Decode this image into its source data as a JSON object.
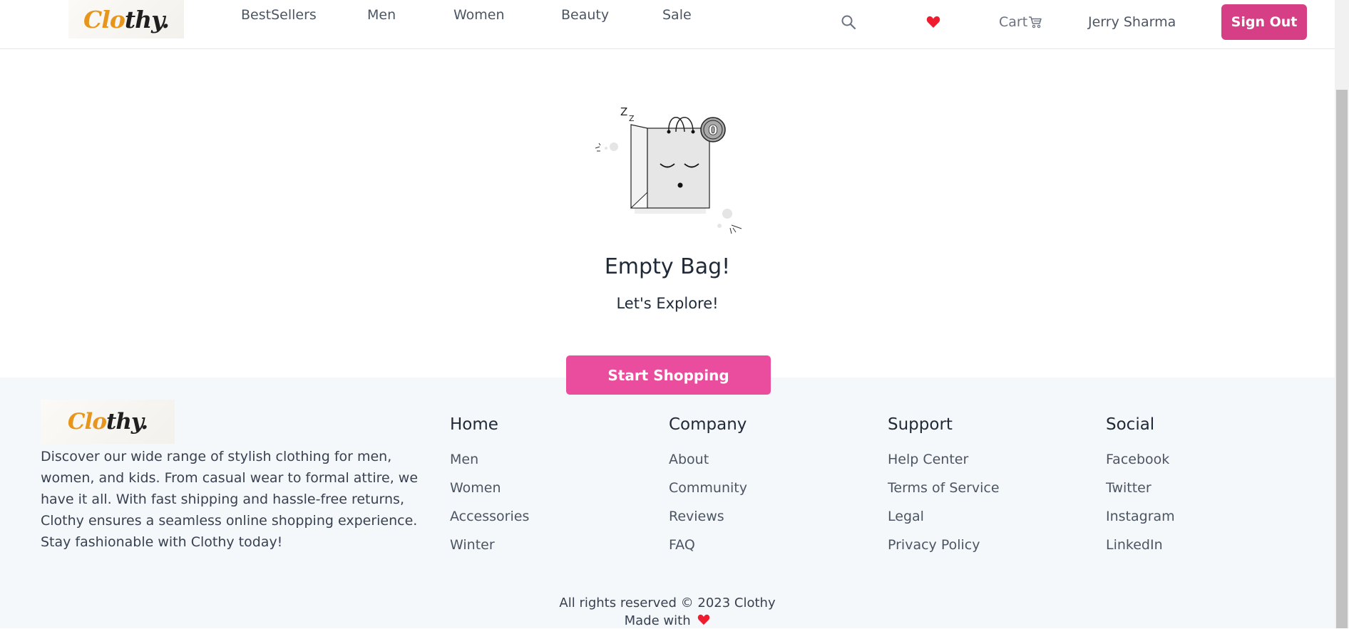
{
  "header": {
    "brand": {
      "part1": "Clo",
      "part2": "thy."
    },
    "nav": [
      {
        "label": "BestSellers"
      },
      {
        "label": "Men"
      },
      {
        "label": "Women"
      },
      {
        "label": "Beauty"
      },
      {
        "label": "Sale"
      }
    ],
    "search_icon": "search-icon",
    "wishlist_icon": "heart-icon",
    "cart_label": "Cart",
    "cart_icon": "cart-icon",
    "user_name": "Jerry Sharma",
    "signout_label": "Sign Out"
  },
  "empty_state": {
    "badge_count": "0",
    "sleep_text": "Z",
    "title": "Empty Bag!",
    "subtitle": "Let's Explore!",
    "button_label": "Start Shopping"
  },
  "footer": {
    "brand": {
      "part1": "Clo",
      "part2": "thy."
    },
    "description": "Discover our wide range of stylish clothing for men, women, and kids. From casual wear to formal attire, we have it all. With fast shipping and hassle-free returns, Clothy ensures a seamless online shopping experience. Stay fashionable with Clothy today!",
    "columns": [
      {
        "title": "Home",
        "links": [
          "Men",
          "Women",
          "Accessories",
          "Winter"
        ]
      },
      {
        "title": "Company",
        "links": [
          "About",
          "Community",
          "Reviews",
          "FAQ"
        ]
      },
      {
        "title": "Support",
        "links": [
          "Help Center",
          "Terms of Service",
          "Legal",
          "Privacy Policy"
        ]
      },
      {
        "title": "Social",
        "links": [
          "Facebook",
          "Twitter",
          "Instagram",
          "LinkedIn"
        ]
      }
    ],
    "copyright": "All rights reserved © 2023 Clothy",
    "made_with": "Made with"
  },
  "colors": {
    "accent": "#d63f86",
    "start_button": "#ea4c9e",
    "brand_orange": "#e8951c",
    "heart": "#e11d48",
    "footer_bg": "#f5f8fa"
  }
}
